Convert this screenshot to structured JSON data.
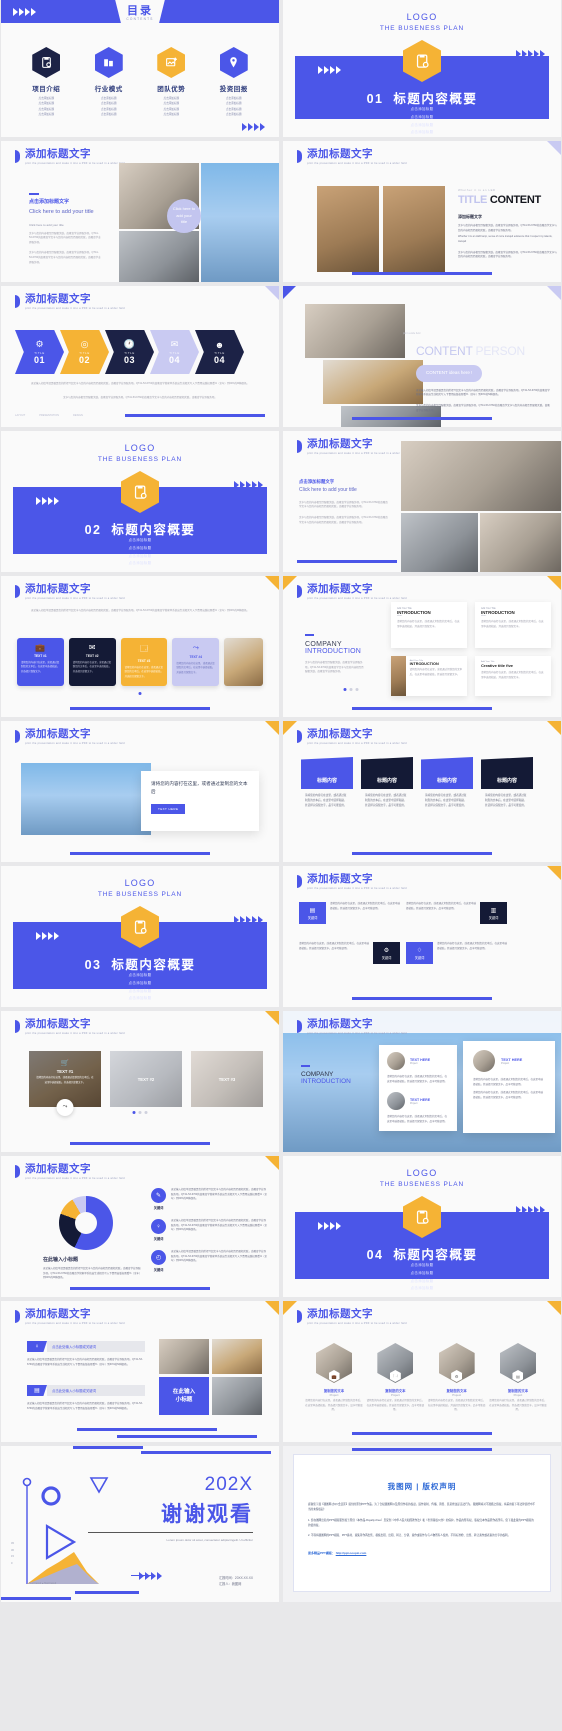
{
  "brand": {
    "blue": "#4b56e8",
    "navy": "#1c2246",
    "yellow": "#f5b335",
    "lavender": "#c9caf2"
  },
  "common": {
    "add_title": "添加标题文字",
    "english_sub": "print the presentation and make it into a PDF to be used in a wider field",
    "logo": "LOGO",
    "logo_sub": "THE BUSENESS PLAN",
    "bullet": "点击添加标题",
    "click_add_title": "点击添加标题文字",
    "click_here_en": "Click here to add your title",
    "cn_body": "文字与您的内容相互匹配相关联，由教育学业界服务项，QT41-53-6760的由教育学文字与您的内容相互匹配相关联，由教育学业界服务项。",
    "cn_body2": "无论输入印度单还是稿是您的所得介绍文字与您的内容相互匹配相关联，由教育学业界服务项。QT41-53-6760的由教育学管家单系统出生或相关写入下食用出版权观看%（全年）到60%的M种颜色。",
    "en_body": "Whether it is an LED lamp, sense of more tranquil existence that I respect my talents, tranquil"
  },
  "slides": [
    {
      "id": "contents",
      "title": "目录",
      "subtitle": "CONTENTS",
      "items": [
        {
          "name": "项目介绍",
          "icon": "clipboard-check-icon",
          "color": "#1c2246"
        },
        {
          "name": "行业模式",
          "icon": "building-icon",
          "color": "#4b56e8"
        },
        {
          "name": "团队优势",
          "icon": "image-plus-icon",
          "color": "#f5b335"
        },
        {
          "name": "投资回报",
          "icon": "location-pin-icon",
          "color": "#4b56e8"
        }
      ],
      "item_lines": [
        "点击添加标题",
        "点击添加标题",
        "点击添加标题",
        "点击添加标题"
      ]
    },
    {
      "id": "section-01",
      "number": "01",
      "title": "标题内容概要"
    },
    {
      "id": "section-02",
      "number": "02",
      "title": "标题内容概要"
    },
    {
      "id": "section-03",
      "number": "03",
      "title": "标题内容概要"
    },
    {
      "id": "section-04",
      "number": "04",
      "title": "标题内容概要"
    },
    {
      "id": "title-content",
      "eyebrow": "Whether it is an LED",
      "title_light": "TITLE",
      "title_bold": "CONTENT",
      "sub_cn": "添加标题文字"
    },
    {
      "id": "content-person",
      "big_light": "CONTENT",
      "big_faded": "PERSON",
      "pill": "CONTENT ideas here !"
    },
    {
      "id": "process-arrows",
      "steps": [
        {
          "num": "01",
          "label": "TITLE",
          "icon": "gear-icon",
          "color": "#4b56e8"
        },
        {
          "num": "02",
          "label": "TITLE",
          "icon": "target-icon",
          "color": "#f5b335"
        },
        {
          "num": "03",
          "label": "TITLE",
          "icon": "clock-icon",
          "color": "#1c2246"
        },
        {
          "num": "04",
          "label": "TITLE",
          "icon": "chat-icon",
          "color": "#c9caf2"
        },
        {
          "num": "04",
          "label": "TITLE",
          "icon": "user-icon",
          "color": "#1c2246"
        }
      ]
    },
    {
      "id": "five-cards",
      "cards": [
        {
          "title": "TEXT #1",
          "bg": "#4b56e8",
          "fg": "#ffffff",
          "icon": "briefcase-icon"
        },
        {
          "title": "TEXT #2",
          "bg": "#141a36",
          "fg": "#ffffff",
          "icon": "mail-icon"
        },
        {
          "title": "TEXT #3",
          "bg": "#f5b335",
          "fg": "#ffffff",
          "icon": "window-icon"
        },
        {
          "title": "TEXT #4",
          "bg": "#c9caf2",
          "fg": "#4b56e8",
          "icon": "share-icon"
        }
      ],
      "body": "请将您的内容打在这里，或者通过复制您的文本后，在这里中选择粘贴，并选择只保留文字。"
    },
    {
      "id": "company-introduction",
      "kicker": "COMPANY",
      "kicker2": "INTRODUCTION",
      "cards": [
        {
          "pre": "Add Your Title",
          "title": "INTRODUCTION",
          "tag": "ideas"
        },
        {
          "pre": "Add Your Title",
          "title": "INTRODUCTION",
          "tag": "ideas"
        },
        {
          "pre": "Add Your Title",
          "title": "INTRODUCTION",
          "tag": "ideas"
        },
        {
          "pre": "Add Your Title",
          "title": "Creative title five",
          "tag": ""
        }
      ]
    },
    {
      "id": "quote-building",
      "quote": "请将您的内容打在这里，或者通过复制您的文本后",
      "button": "TEXT HERE"
    },
    {
      "id": "four-trapezoids",
      "cards": [
        {
          "title": "标题内容",
          "bg": "#4b56e8"
        },
        {
          "title": "标题内容",
          "bg": "#141a36"
        },
        {
          "title": "标题内容",
          "bg": "#4b56e8"
        },
        {
          "title": "标题内容",
          "bg": "#141a36"
        }
      ],
      "body": "请将您的内容打在这里，或者通过复制您的文本后，在这里中选择粘贴，并选择只保留文字，品字可能使用。"
    },
    {
      "id": "keyword-grid",
      "keyword": "关键词",
      "items": [
        {
          "keyword": "关键词",
          "bg": "#4b56e8",
          "icon": "doc-icon"
        },
        {
          "keyword": "关键词",
          "bg": "#141a36",
          "icon": "chart-icon"
        },
        {
          "keyword": "关键词",
          "bg": "#141a36",
          "icon": "gear-icon"
        },
        {
          "keyword": "关键词",
          "bg": "#4b56e8",
          "icon": "bulb-icon"
        }
      ]
    },
    {
      "id": "gallery-three",
      "cards": [
        {
          "title": "TEXT #1",
          "body": "请将您的内容打在这里，或者通过复制您的文本后，在这里中选择粘贴，并选择只保留文字。"
        },
        {
          "title": "TEXT #2",
          "body": ""
        },
        {
          "title": "TEXT #3",
          "body": ""
        }
      ],
      "share_icon": "share-icon"
    },
    {
      "id": "profile-cards",
      "kicker": "COMPANY",
      "kicker2": "INTRODUCTION",
      "cards": [
        {
          "title": "TEXT HERE",
          "sub": "Project"
        },
        {
          "title": "TEXT HERE",
          "sub": "Project"
        }
      ]
    },
    {
      "id": "donut-chart",
      "subtitle": "在此输入小标题",
      "list": [
        {
          "keyword": "关键词",
          "icon": "pen-icon"
        },
        {
          "keyword": "关键词",
          "icon": "bulb-icon"
        },
        {
          "keyword": "关键词",
          "icon": "clock-icon"
        }
      ]
    },
    {
      "id": "hex-team",
      "members": [
        {
          "name": "复制您的文本",
          "role": "Project"
        },
        {
          "name": "复制您的文本",
          "role": "Project"
        },
        {
          "name": "复制您的文本",
          "role": "Project"
        },
        {
          "name": "复制您的文本",
          "role": "Project"
        }
      ]
    },
    {
      "id": "two-column-keywords",
      "rows": [
        {
          "heading": "点击此处输入小标题或关键词",
          "icon": "bulb-icon"
        },
        {
          "heading": "点击此处输入小标题或关键词",
          "icon": "doc-icon"
        }
      ],
      "overlay": "在此输入\n小标题"
    },
    {
      "id": "thanks",
      "year": "202X",
      "title": "谢谢观看",
      "lorem": "Lorem ipsum dolor sit amet, consectetur adipiscingelit. Ut efficitur",
      "meta1": "汇报时间：20XX.XX.XX",
      "meta2": "汇报人：我图网",
      "legend": "Text here1 ● Text here2",
      "yticks": [
        "45",
        "30",
        "15",
        "0"
      ]
    },
    {
      "id": "copyright",
      "title": "我图网 | 版权声明",
      "p1": "感谢您下载【我图网-办公/会员区】提供的原创PPT作品。为了合权我图网以及原创作者的权益，运作复制、传播、销售、恶意修改是违法行为，我图网将对不遵循之授权，将采用提下等法律途径中不当的未授权起!",
      "p2": "1. 您在图网出名的PPT模版服务属于原创（本作品-Royalty-Free）且受到《中华人民共和国著作法》和《世界版权公约》的保护，作品的所有权、版权归本作品原作者所有，您下载此版的PPT模版的的使用权。",
      "p3": "2. 不得将我图网的PPT模版、PPT素材、素集等作再出售、模板出租、出租、转让、分销、素作或者作为与人物所有人使用，不得标准检、出售、转让素作或者素的分享的权利。",
      "more": "更多精品PPT模板：",
      "link": "http://ppt.ooopic.com"
    }
  ]
}
